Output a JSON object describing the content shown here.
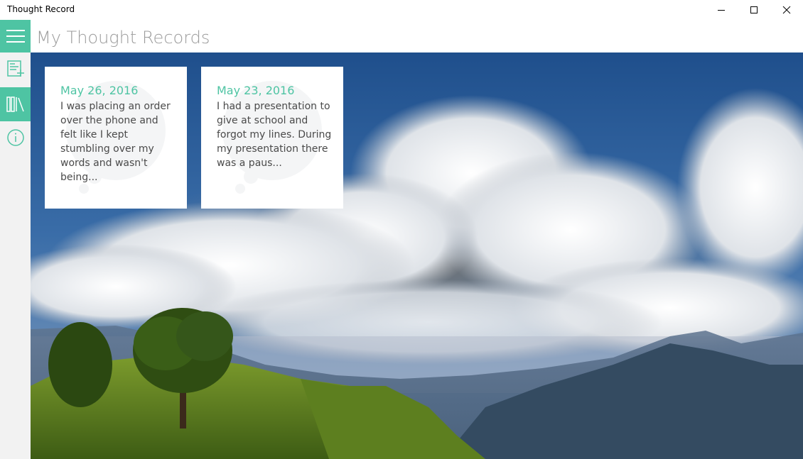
{
  "window": {
    "title": "Thought Record",
    "controls": {
      "minimize": "minimize-icon",
      "maximize": "maximize-icon",
      "close": "close-icon"
    }
  },
  "nav": {
    "items": [
      {
        "icon": "hamburger-menu-icon",
        "active": true
      },
      {
        "icon": "new-record-icon",
        "active": false
      },
      {
        "icon": "library-icon",
        "active": true
      },
      {
        "icon": "info-icon",
        "active": false
      }
    ]
  },
  "header": {
    "title": "My Thought Records"
  },
  "records": [
    {
      "date": "May 26, 2016",
      "excerpt": "I was placing an order over the phone and felt like I kept stumbling over my words and wasn't being..."
    },
    {
      "date": "May 23, 2016",
      "excerpt": "I had a presentation to give at school and forgot my lines. During my presentation there was a paus..."
    }
  ],
  "colors": {
    "accent": "#4ec4a3",
    "rail": "#f2f2f2",
    "title_gray": "#9b9b9b",
    "body_text": "#4a4a4a"
  }
}
